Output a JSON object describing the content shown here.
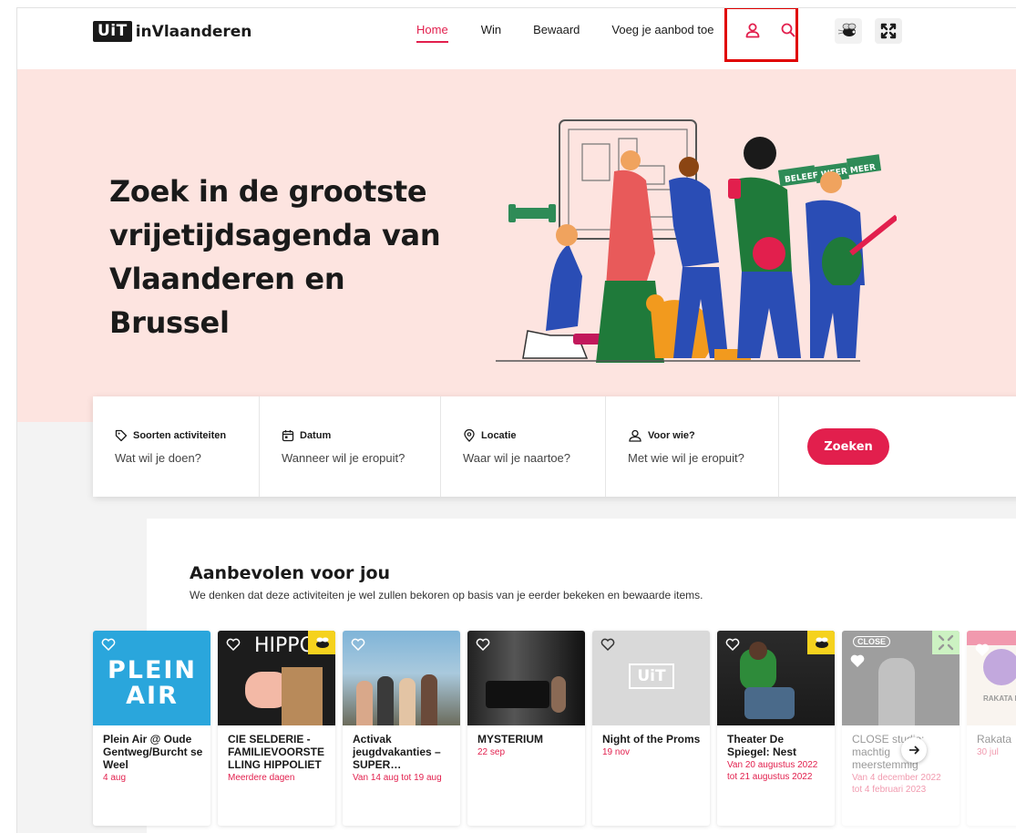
{
  "header": {
    "logo_box": "UiT",
    "logo_text": "inVlaanderen",
    "nav": [
      {
        "label": "Home"
      },
      {
        "label": "Win"
      },
      {
        "label": "Bewaard"
      },
      {
        "label": "Voeg je aanbod toe"
      }
    ]
  },
  "hero": {
    "title": "Zoek in de grootste vrijetijdsagenda van Vlaanderen en Brussel",
    "sign": "BELEEF WEER MEER"
  },
  "search": {
    "fields": [
      {
        "label": "Soorten activiteiten",
        "placeholder": "Wat wil je doen?"
      },
      {
        "label": "Datum",
        "placeholder": "Wanneer wil je eropuit?"
      },
      {
        "label": "Locatie",
        "placeholder": "Waar wil je naartoe?"
      },
      {
        "label": "Voor wie?",
        "placeholder": "Met wie wil je eropuit?"
      }
    ],
    "button": "Zoeken"
  },
  "recommended": {
    "title": "Aanbevolen voor jou",
    "subtitle": "We denken dat deze activiteiten je wel zullen bekoren op basis van je eerder bekeken en bewaarde items.",
    "cards": [
      {
        "title": "Plein Air @ Oude Gentweg/Burcht se Weel",
        "date": "4 aug",
        "image_text": "PLEIN AIR"
      },
      {
        "title": "CIE SELDERIE - FAMILIEVOORSTE LLING HIPPOLIET",
        "date": "Meerdere dagen",
        "image_text": "HIPPOL"
      },
      {
        "title": "Activak jeugdvakanties – SUPER…",
        "date": "Van 14 aug tot 19 aug"
      },
      {
        "title": "MYSTERIUM",
        "date": "22 sep"
      },
      {
        "title": "Night of the Proms",
        "date": "19 nov",
        "image_text": "UiT"
      },
      {
        "title": "Theater De Spiegel: Nest",
        "date": "Van 20 augustus 2022 tot 21 augustus 2022"
      },
      {
        "title": "CLOSE studio: machtig meerstemmig",
        "date": "Van 4 december 2022 tot 4 februari 2023",
        "image_text": "CLOSE"
      },
      {
        "title": "Rakata",
        "date": "30 jul",
        "image_text": "RAKATA FESTIV"
      }
    ]
  },
  "colors": {
    "accent": "#e21f4d",
    "hero_bg": "#fde4e0",
    "highlight": "#e00000"
  }
}
